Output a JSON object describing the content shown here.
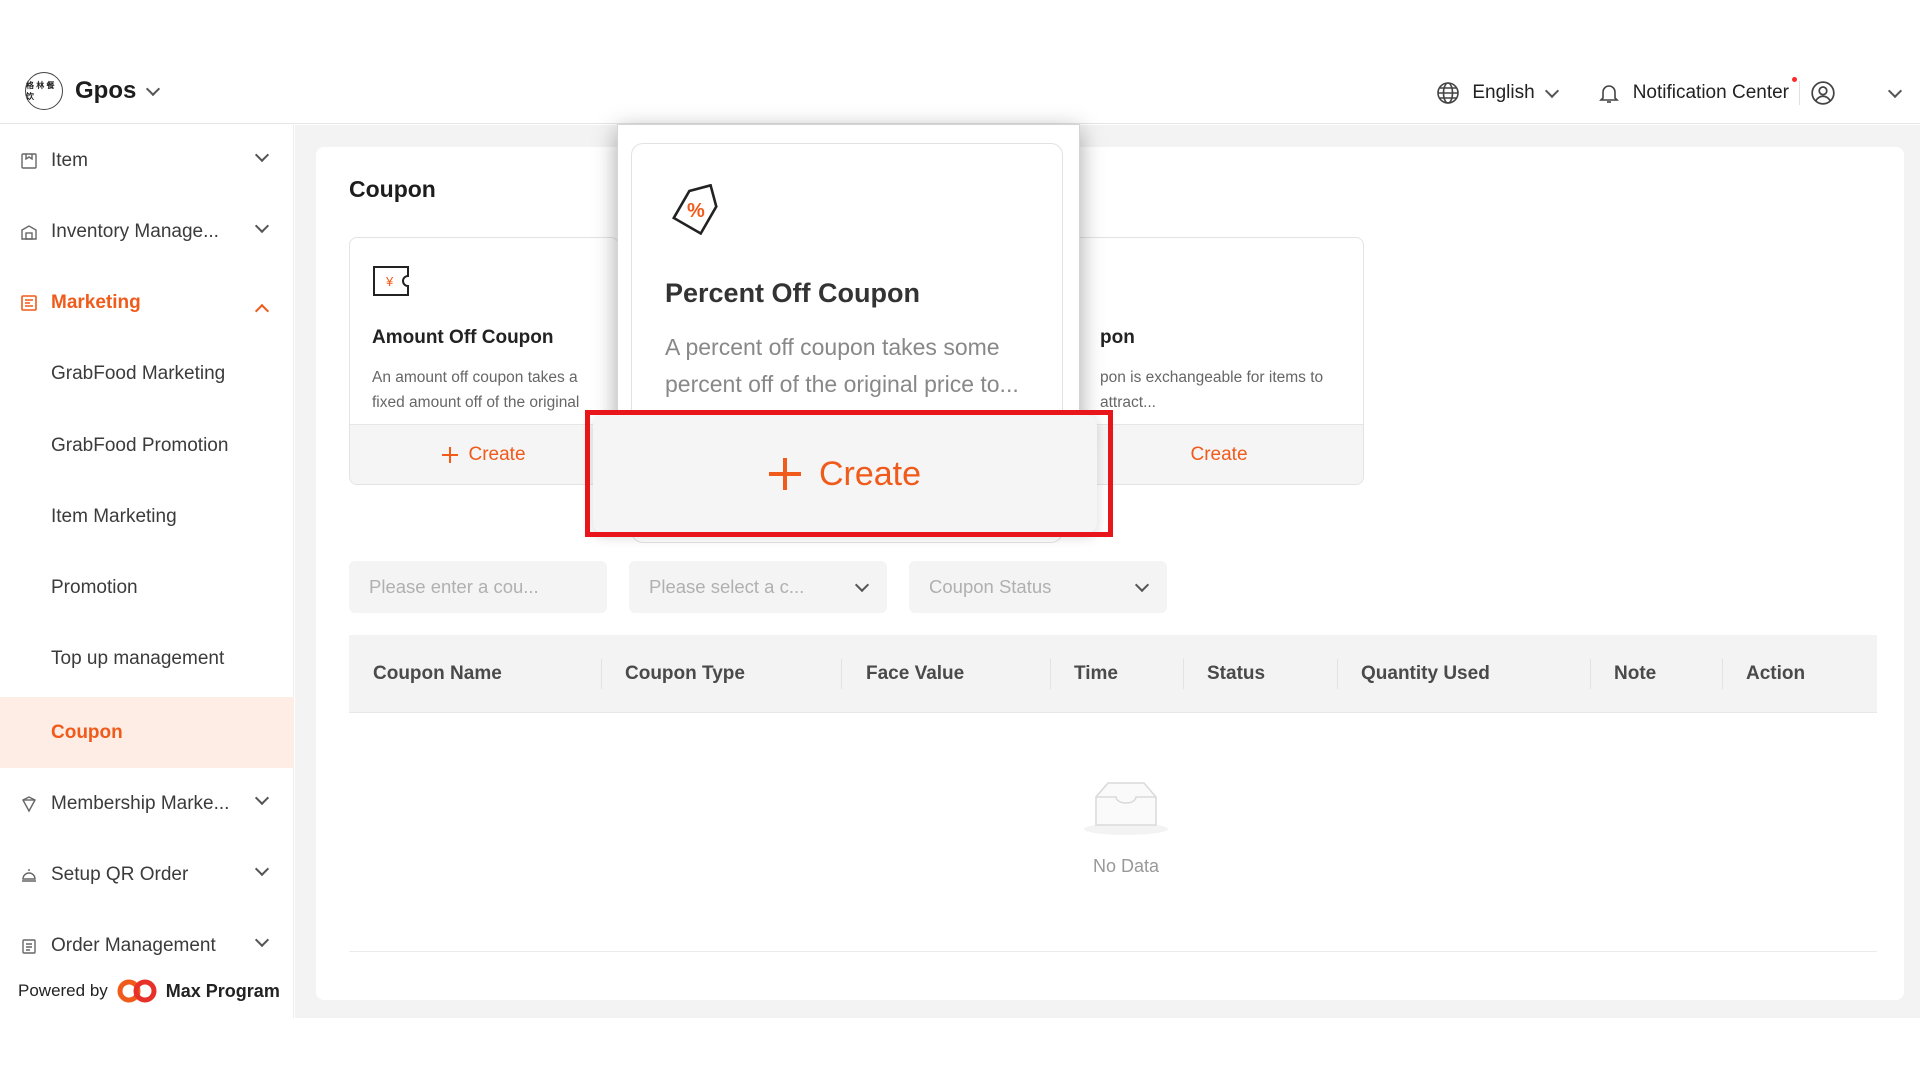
{
  "header": {
    "logo_text": "格 林 餐 饮",
    "brand": "Gpos",
    "language": "English",
    "notification": "Notification Center"
  },
  "sidebar": {
    "items": [
      {
        "label": "Item"
      },
      {
        "label": "Inventory Manage..."
      },
      {
        "label": "Marketing"
      },
      {
        "label": "GrabFood Marketing"
      },
      {
        "label": "GrabFood Promotion"
      },
      {
        "label": "Item Marketing"
      },
      {
        "label": "Promotion"
      },
      {
        "label": "Top up management"
      },
      {
        "label": "Coupon"
      },
      {
        "label": "Membership Marke..."
      },
      {
        "label": "Setup QR Order"
      },
      {
        "label": "Order Management"
      }
    ],
    "powered_by": "Powered by",
    "powered_brand": "Max Program"
  },
  "main": {
    "title": "Coupon",
    "cards": [
      {
        "title": "Amount Off Coupon",
        "desc": "An amount off coupon takes a fixed amount off of the original price to...",
        "create": "Create"
      },
      {
        "title": "pon",
        "desc": "pon is exchangeable for items to attract...",
        "create": "Create"
      }
    ],
    "filters": {
      "name_placeholder": "Please enter a cou...",
      "type_placeholder": "Please select a c...",
      "status_placeholder": "Coupon Status"
    },
    "table": {
      "columns": [
        "Coupon Name",
        "Coupon Type",
        "Face Value",
        "Time",
        "Status",
        "Quantity Used",
        "Note",
        "Action"
      ],
      "empty": "No Data"
    }
  },
  "popup": {
    "title": "Percent Off Coupon",
    "desc": "A percent off coupon takes some percent off of the original price to...",
    "create": "Create"
  },
  "colors": {
    "accent": "#f05a1a",
    "highlight": "#e8161b"
  }
}
